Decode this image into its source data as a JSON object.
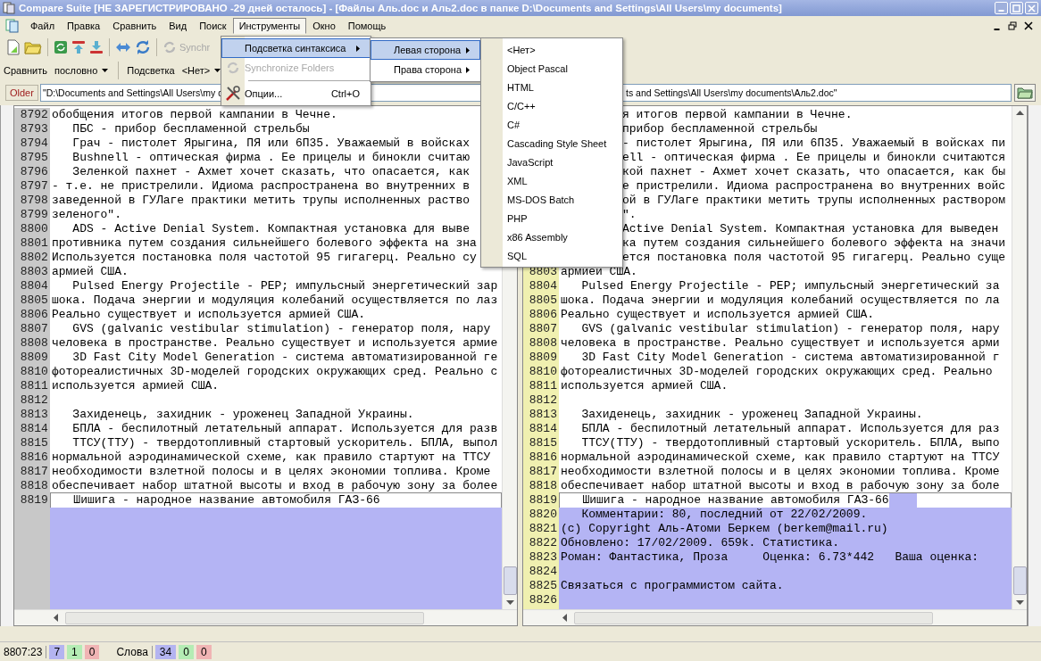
{
  "window": {
    "title": "Compare Suite [НЕ ЗАРЕГИСТРИРОВАНО -29 дней осталось] - [Файлы Аль.doc и Аль2.doc в папке D:\\Documents and Settings\\All Users\\my documents]"
  },
  "menu_bar": [
    {
      "label": "Файл",
      "selected": false
    },
    {
      "label": "Правка",
      "selected": false
    },
    {
      "label": "Сравнить",
      "selected": false
    },
    {
      "label": "Вид",
      "selected": false
    },
    {
      "label": "Поиск",
      "selected": false
    },
    {
      "label": "Инструменты",
      "selected": true
    },
    {
      "label": "Окно",
      "selected": false
    },
    {
      "label": "Помощь",
      "selected": false
    }
  ],
  "toolbar": {
    "synchronize_label": "Synchr"
  },
  "compare_mode": {
    "label": "Сравнить",
    "value": "пословно"
  },
  "highlight": {
    "label": "Подсветка",
    "value": "<Нет>"
  },
  "left_file": {
    "tag": "Older",
    "path": "\"D:\\Documents and Settings\\All Users\\my d"
  },
  "right_file": {
    "path": "ts and Settings\\All Users\\my documents\\Аль2.doc\""
  },
  "panes": [
    {
      "rows": [
        {
          "number": "8792",
          "text": "обобщения итогов первой кампании в Чечне.",
          "kind": "normal"
        },
        {
          "number": "8793",
          "text": "   ПБС - прибор беспламенной стрельбы",
          "kind": "normal"
        },
        {
          "number": "8794",
          "text": "   Грач - пистолет Ярыгина, ПЯ или 6П35. Уважаемый в войсках",
          "kind": "normal"
        },
        {
          "number": "8795",
          "text": "   Bushnell - оптическая фирма . Ее прицелы и бинокли считаю",
          "kind": "normal"
        },
        {
          "number": "8796",
          "text": "   Зеленкой пахнет - Ахмет хочет сказать, что опасается, как",
          "kind": "normal"
        },
        {
          "number": "8797",
          "text": "- т.е. не пристрелили. Идиома распространена во внутренних в",
          "kind": "normal"
        },
        {
          "number": "8798",
          "text": "заведенной в ГУЛаге практики метить трупы исполненных раство",
          "kind": "normal"
        },
        {
          "number": "8799",
          "text": "зеленого\".",
          "kind": "normal"
        },
        {
          "number": "8800",
          "text": "   ADS - Active Denial System. Компактная установка для выве",
          "kind": "normal"
        },
        {
          "number": "8801",
          "text": "противника путем создания сильнейшего болевого эффекта на зна",
          "kind": "normal"
        },
        {
          "number": "8802",
          "text": "Используется постановка поля частотой 95 гигагерц. Реально су",
          "kind": "normal"
        },
        {
          "number": "8803",
          "text": "армией США.",
          "kind": "normal"
        },
        {
          "number": "8804",
          "text": "   Pulsed Energy Projectile - PEP; импульсный энергетический зар",
          "kind": "normal"
        },
        {
          "number": "8805",
          "text": "шока. Подача энергии и модуляция колебаний осуществляется по лаз",
          "kind": "normal"
        },
        {
          "number": "8806",
          "text": "Реально существует и используется армией США.",
          "kind": "normal"
        },
        {
          "number": "8807",
          "text": "   GVS (galvanic vestibular stimulation) - генератор поля, нару",
          "kind": "normal"
        },
        {
          "number": "8808",
          "text": "человека в пространстве. Реально существует и используется армие",
          "kind": "normal"
        },
        {
          "number": "8809",
          "text": "   3D Fast City Model Generation - система автоматизированной ге",
          "kind": "normal"
        },
        {
          "number": "8810",
          "text": "фотореалистичных 3D-моделей городских окружающих сред. Реально с",
          "kind": "normal"
        },
        {
          "number": "8811",
          "text": "используется армией США.",
          "kind": "normal"
        },
        {
          "number": "8812",
          "kind": "normal"
        },
        {
          "number": "8813",
          "text": "   Захиденець, захидник - уроженец Западной Украины.",
          "kind": "normal"
        },
        {
          "number": "8814",
          "text": "   БПЛА - беспилотный летательный аппарат. Используется для разв",
          "kind": "normal"
        },
        {
          "number": "8815",
          "text": "   ТТСУ(ТТУ) - твердотопливный стартовый ускоритель. БПЛА, выпол",
          "kind": "normal"
        },
        {
          "number": "8816",
          "text": "нормальной аэродинамической схеме, как правило стартуют на ТТСУ",
          "kind": "normal"
        },
        {
          "number": "8817",
          "text": "необходимости взлетной полосы и в целях экономии топлива. Кроме",
          "kind": "normal"
        },
        {
          "number": "8818",
          "text": "обеспечивает набор штатной высоты и вход в рабочую зону за более",
          "kind": "normal"
        },
        {
          "number": "8819",
          "text": "   Шишига - народное название автомобиля ГАЗ-66",
          "kind": "current",
          "trailing_change": false
        }
      ]
    },
    {
      "rows": [
        {
          "text": "я итогов первой кампании в Чечне.",
          "kind": "hidden_start"
        },
        {
          "text": "прибор беспламенной стрельбы",
          "kind": "hidden_start"
        },
        {
          "text": "- пистолет Ярыгина, ПЯ или 6П35. Уважаемый в войсках пи",
          "kind": "hidden_start"
        },
        {
          "text": "ell - оптическая фирма . Ее прицелы и бинокли считаются",
          "kind": "hidden_start"
        },
        {
          "text": "кой пахнет - Ахмет хочет сказать, что опасается, как бы",
          "kind": "hidden_start"
        },
        {
          "text": "е пристрелили. Идиома распространена во внутренних войс",
          "kind": "hidden_start"
        },
        {
          "text": "ой в ГУЛаге практики метить трупы исполненных раствором",
          "kind": "hidden_start"
        },
        {
          "text": "\".",
          "kind": "hidden_start"
        },
        {
          "text": "Active Denial System. Компактная установка для выведен",
          "kind": "hidden_start"
        },
        {
          "text": "ка путем создания сильнейшего болевого эффекта на значи",
          "kind": "hidden_start"
        },
        {
          "text": "ется постановка поля частотой 95 гигагерц. Реально суще",
          "kind": "hidden_start"
        },
        {
          "number": "8803",
          "text": "армией США.",
          "kind": "normal"
        },
        {
          "number": "8804",
          "text": "   Pulsed Energy Projectile - PEP; импульсный энергетический за",
          "kind": "normal"
        },
        {
          "number": "8805",
          "text": "шока. Подача энергии и модуляция колебаний осуществляется по ла",
          "kind": "normal"
        },
        {
          "number": "8806",
          "text": "Реально существует и используется армией США.",
          "kind": "normal"
        },
        {
          "number": "8807",
          "text": "   GVS (galvanic vestibular stimulation) - генератор поля, нару",
          "kind": "normal"
        },
        {
          "number": "8808",
          "text": "человека в пространстве. Реально существует и используется арми",
          "kind": "normal"
        },
        {
          "number": "8809",
          "text": "   3D Fast City Model Generation - система автоматизированной г",
          "kind": "normal"
        },
        {
          "number": "8810",
          "text": "фотореалистичных 3D-моделей городских окружающих сред. Реально",
          "kind": "normal"
        },
        {
          "number": "8811",
          "text": "используется армией США.",
          "kind": "normal"
        },
        {
          "number": "8812",
          "kind": "normal"
        },
        {
          "number": "8813",
          "text": "   Захиденець, захидник - уроженец Западной Украины.",
          "kind": "normal"
        },
        {
          "number": "8814",
          "text": "   БПЛА - беспилотный летательный аппарат. Используется для раз",
          "kind": "normal"
        },
        {
          "number": "8815",
          "text": "   ТТСУ(ТТУ) - твердотопливный стартовый ускоритель. БПЛА, выпо",
          "kind": "normal"
        },
        {
          "number": "8816",
          "text": "нормальной аэродинамической схеме, как правило стартуют на ТТСУ",
          "kind": "normal"
        },
        {
          "number": "8817",
          "text": "необходимости взлетной полосы и в целях экономии топлива. Кроме",
          "kind": "normal"
        },
        {
          "number": "8818",
          "text": "обеспечивает набор штатной высоты и вход в рабочую зону за боле",
          "kind": "normal"
        },
        {
          "number": "8819",
          "text": "   Шишига - народное название автомобиля ГАЗ-66",
          "kind": "current",
          "trailing_change": true
        },
        {
          "number": "8820",
          "text": "   Комментарии: 80, последний от 22/02/2009.",
          "kind": "added"
        },
        {
          "number": "8821",
          "text": "(c) Copyright Аль-Атоми Беркем (berkem@mail.ru)",
          "kind": "added"
        },
        {
          "number": "8822",
          "text": "Обновлено: 17/02/2009. 659k. Статистика.",
          "kind": "added"
        },
        {
          "number": "8823",
          "text": "Роман: Фантастика, Проза     Оценка: 6.73*442   Ваша оценка:",
          "kind": "added"
        },
        {
          "number": "8824",
          "kind": "added"
        },
        {
          "number": "8825",
          "text": "Связаться с программистом сайта.",
          "kind": "added"
        },
        {
          "number": "8826",
          "kind": "added"
        }
      ]
    }
  ],
  "status_bar": {
    "position": "8807:23",
    "line_counts": [
      {
        "value": "7",
        "color": "#b4b4f0"
      },
      {
        "value": "1",
        "color": "#b4ecb4"
      },
      {
        "value": "0",
        "color": "#f0b4b4"
      }
    ],
    "words_label": "Слова",
    "word_counts": [
      {
        "value": "34",
        "color": "#b4b4f0"
      },
      {
        "value": "0",
        "color": "#b4ecb4"
      },
      {
        "value": "0",
        "color": "#f0b4b4"
      }
    ]
  },
  "tools_menu": {
    "items": [
      {
        "kind": "submenu",
        "label": "Подсветка синтаксиса",
        "selected": true,
        "disabled": false
      },
      {
        "kind": "item",
        "label": "Synchronize Folders",
        "selected": false,
        "disabled": true
      },
      {
        "kind": "separator"
      },
      {
        "kind": "item",
        "label": "Опции...",
        "shortcut": "Ctrl+O",
        "selected": false,
        "disabled": false
      }
    ]
  },
  "syntax_side_menu": {
    "items": [
      {
        "label": "Левая сторона",
        "selected": true
      },
      {
        "label": "Права сторона",
        "selected": false
      }
    ]
  },
  "language_menu": {
    "items": [
      {
        "label": "<Нет>",
        "selected": false
      },
      {
        "label": "Object Pascal",
        "selected": false
      },
      {
        "label": "HTML",
        "selected": false
      },
      {
        "label": "C/C++",
        "selected": false
      },
      {
        "label": "C#",
        "selected": false
      },
      {
        "label": "Cascading Style Sheet",
        "selected": false
      },
      {
        "label": "JavaScript",
        "selected": false
      },
      {
        "label": "XML",
        "selected": false
      },
      {
        "label": "MS-DOS Batch",
        "selected": false
      },
      {
        "label": "PHP",
        "selected": false
      },
      {
        "label": "x86 Assembly",
        "selected": false
      },
      {
        "label": "SQL",
        "selected": false
      }
    ]
  }
}
